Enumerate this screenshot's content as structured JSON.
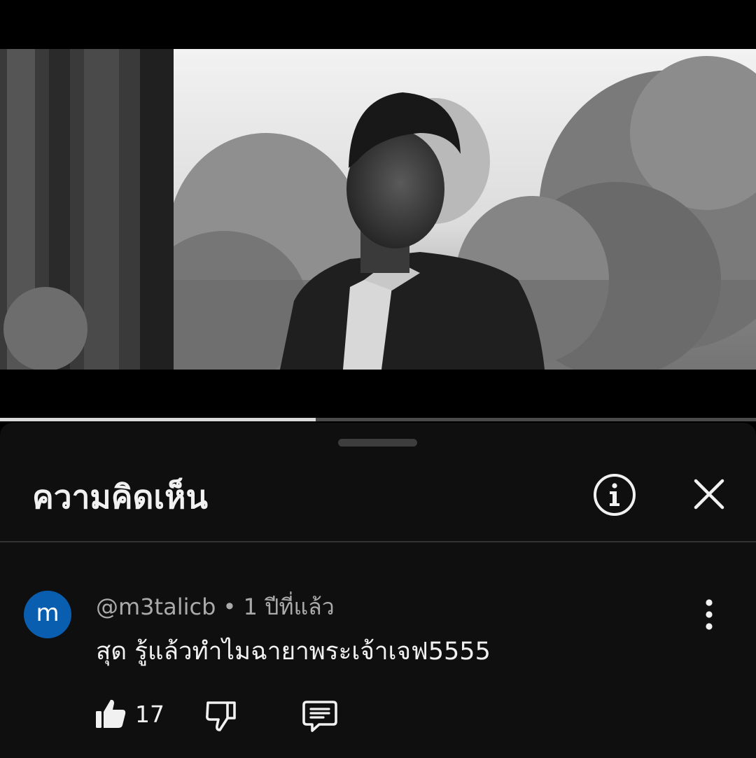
{
  "player": {
    "progress_fraction": 0.418
  },
  "comments_panel": {
    "title": "ความคิดเห็น",
    "info_icon": "info-icon",
    "close_icon": "close-icon"
  },
  "comment": {
    "avatar_letter": "m",
    "avatar_color": "#0a5eb0",
    "author": "@m3talicb",
    "separator": " • ",
    "time": "1 ปีที่แล้ว",
    "text": "สุด รู้แล้วทำไมฉายาพระเจ้าเจฟ5555",
    "like_count": "17",
    "icons": {
      "like": "thumbs-up-icon",
      "dislike": "thumbs-down-icon",
      "reply": "reply-icon",
      "more": "more-vert-icon"
    }
  }
}
